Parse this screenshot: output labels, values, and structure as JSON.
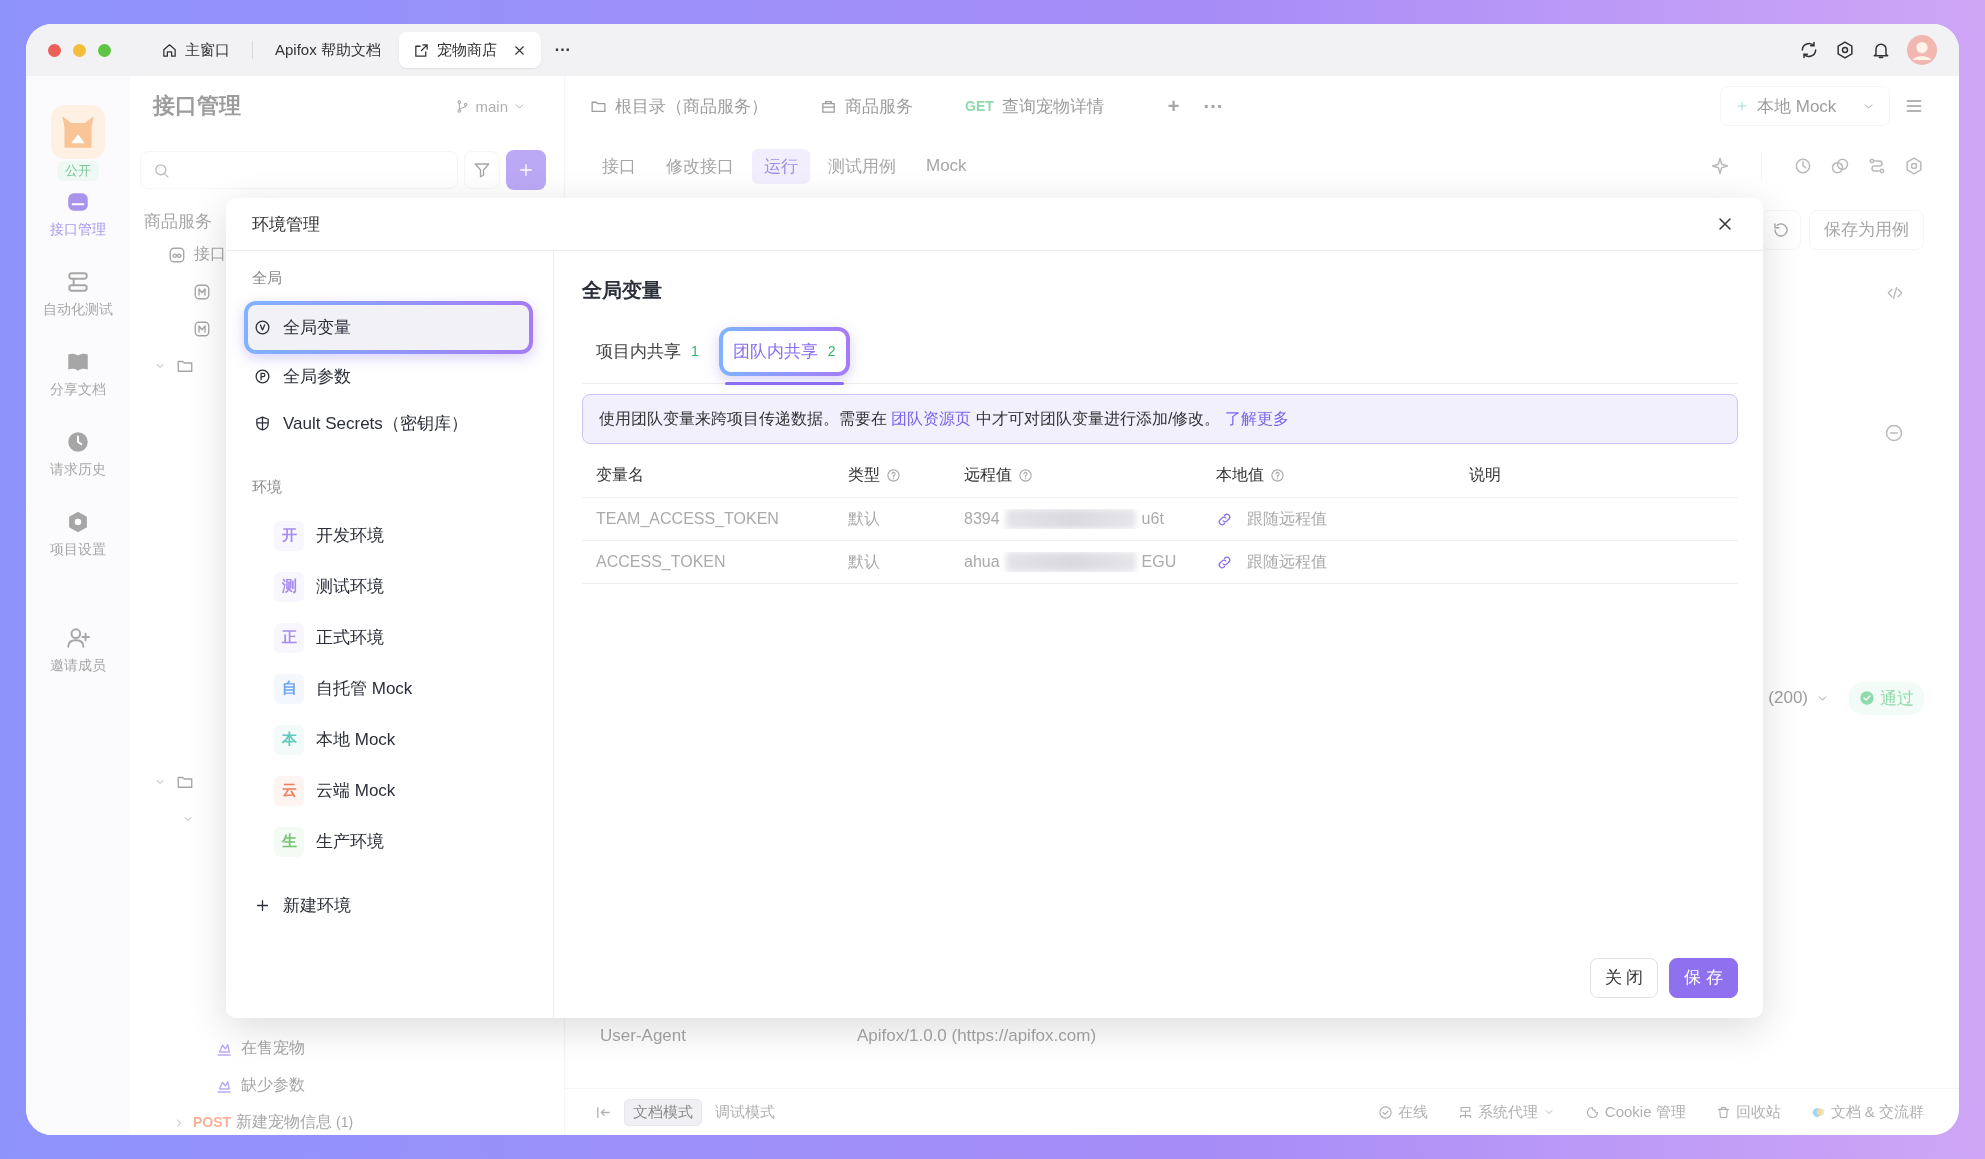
{
  "title_bar": {
    "tabs": [
      {
        "kind": "home",
        "label": "主窗口",
        "selected": false
      },
      {
        "kind": "plain",
        "label": "Apifox 帮助文档",
        "selected": false
      },
      {
        "kind": "project",
        "label": "宠物商店",
        "selected": true
      }
    ],
    "more": "···"
  },
  "rail": {
    "badge": "公开",
    "items": [
      {
        "kind": "api",
        "label": "接口管理",
        "selected": true
      },
      {
        "kind": "auto",
        "label": "自动化测试",
        "selected": false
      },
      {
        "kind": "share",
        "label": "分享文档",
        "selected": false
      },
      {
        "kind": "history",
        "label": "请求历史",
        "selected": false
      },
      {
        "kind": "settings",
        "label": "项目设置",
        "selected": false
      },
      {
        "kind": "invite",
        "label": "邀请成员",
        "selected": false
      }
    ]
  },
  "panel": {
    "title": "接口管理",
    "branch": "main",
    "tree_title": "商品服务",
    "tree_top": [
      {
        "kind": "root",
        "label": "接口"
      },
      {
        "kind": "method"
      },
      {
        "kind": "method"
      },
      {
        "kind": "folder"
      }
    ],
    "tree_mid": [
      {
        "kind": "folder"
      },
      {
        "kind": "chevron"
      }
    ],
    "tree_bottom": [
      {
        "kind": "case",
        "label": "在售宠物"
      },
      {
        "kind": "case",
        "label": "缺少参数"
      },
      {
        "kind": "request",
        "method": "POST",
        "label": "新建宠物信息",
        "count": "(1)"
      }
    ]
  },
  "tabs": [
    {
      "kind": "folder",
      "label": "根目录（商品服务）"
    },
    {
      "kind": "service",
      "label": "商品服务"
    },
    {
      "kind": "request",
      "method": "GET",
      "label": "查询宠物详情"
    }
  ],
  "tab_actions": {
    "add": "+",
    "more": "···"
  },
  "environment_select": {
    "label": "本地 Mock"
  },
  "sub_tabs": [
    {
      "label": "接口",
      "selected": false
    },
    {
      "label": "修改接口",
      "selected": false
    },
    {
      "label": "运行",
      "selected": true
    },
    {
      "label": "测试用例",
      "selected": false
    },
    {
      "label": "Mock",
      "selected": false
    }
  ],
  "save_case_button": "保存为用例",
  "response": {
    "status": "(200)",
    "result": "通过"
  },
  "header_row": {
    "name": "User-Agent",
    "value": "Apifox/1.0.0 (https://apifox.com)"
  },
  "status_bar": {
    "modes": [
      {
        "label": "文档模式",
        "selected": true
      },
      {
        "label": "调试模式",
        "selected": false
      }
    ],
    "items": [
      {
        "kind": "online",
        "label": "在线"
      },
      {
        "kind": "proxy",
        "label": "系统代理"
      },
      {
        "kind": "cookie",
        "label": "Cookie 管理"
      },
      {
        "kind": "trash",
        "label": "回收站"
      },
      {
        "kind": "community",
        "label": "文档 & 交流群"
      }
    ]
  },
  "modal": {
    "title": "环境管理",
    "sections": [
      {
        "title": "全局",
        "items": [
          {
            "kind": "variable",
            "label": "全局变量",
            "selected": true
          },
          {
            "kind": "param",
            "label": "全局参数",
            "selected": false
          },
          {
            "kind": "vault",
            "label": "Vault Secrets（密钥库）",
            "selected": false
          }
        ]
      },
      {
        "title": "环境",
        "items": [
          {
            "kind": "env",
            "badge": "开",
            "label": "开发环境",
            "color": "#a68cf2",
            "selected": false
          },
          {
            "kind": "env",
            "badge": "测",
            "label": "测试环境",
            "color": "#a68cf2",
            "selected": false
          },
          {
            "kind": "env",
            "badge": "正",
            "label": "正式环境",
            "color": "#a68cf2",
            "selected": false
          },
          {
            "kind": "env",
            "badge": "自",
            "label": "自托管 Mock",
            "color": "#6da4f0",
            "selected": false
          },
          {
            "kind": "env",
            "badge": "本",
            "label": "本地 Mock",
            "color": "#62c9bf",
            "selected": false
          },
          {
            "kind": "env",
            "badge": "云",
            "label": "云端 Mock",
            "color": "#ef7d5e",
            "selected": false
          },
          {
            "kind": "env",
            "badge": "生",
            "label": "生产环境",
            "color": "#73c570",
            "selected": false
          }
        ]
      }
    ],
    "add": "新建环境",
    "heading": "全局变量",
    "scope_tabs": [
      {
        "label": "项目内共享",
        "count": "1",
        "selected": false
      },
      {
        "label": "团队内共享",
        "count": "2",
        "selected": true
      }
    ],
    "notice": {
      "before": "使用团队变量来跨项目传递数据。需要在",
      "link": "团队资源页",
      "after": "中才可对团队变量进行添加/修改。",
      "more_link": "了解更多"
    },
    "table": {
      "columns": [
        {
          "label": "变量名",
          "help": false
        },
        {
          "label": "类型",
          "help": true
        },
        {
          "label": "远程值",
          "help": true
        },
        {
          "label": "本地值",
          "help": true
        },
        {
          "label": "说明",
          "help": false
        }
      ],
      "rows": [
        {
          "name": "TEAM_ACCESS_TOKEN",
          "type": "默认",
          "remote_start": "8394",
          "remote_end": "u6t",
          "local": "跟随远程值"
        },
        {
          "name": "ACCESS_TOKEN",
          "type": "默认",
          "remote_start": "ahua",
          "remote_end": "EGU",
          "local": "跟随远程值"
        }
      ]
    },
    "buttons": [
      {
        "kind": "secondary",
        "label": "关 闭"
      },
      {
        "kind": "primary",
        "label": "保 存"
      }
    ]
  }
}
